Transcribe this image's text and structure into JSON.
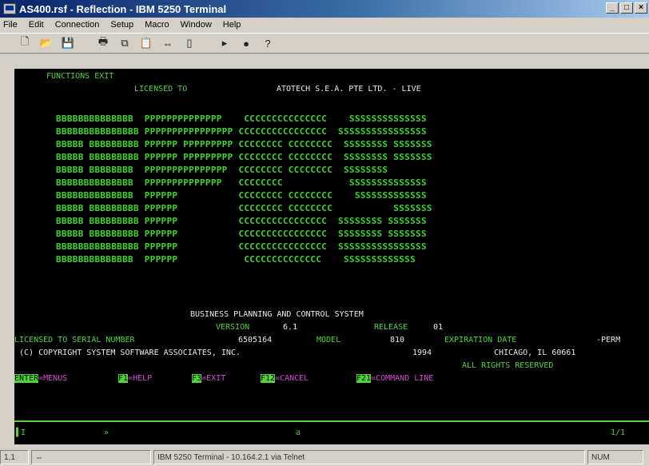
{
  "window": {
    "title": "AS400.rsf - Reflection - IBM 5250 Terminal",
    "buttons": [
      "_",
      "□",
      "×"
    ]
  },
  "menus": [
    "File",
    "Edit",
    "Connection",
    "Setup",
    "Macro",
    "Window",
    "Help"
  ],
  "toolbar_icons": [
    "new-icon",
    "open-icon",
    "save-icon",
    "print-icon",
    "copy-icon",
    "paste-icon",
    "connect-icon",
    "disconnect-icon",
    "record-icon",
    "stop-icon",
    "help-icon"
  ],
  "terminal": {
    "header_left": "FUNCTIONS EXIT",
    "licensed_label": "LICENSED TO",
    "licensee": "ATOTECH S.E.A. PTE LTD. - LIVE",
    "logo": [
      "BBBBBBBBBBBBBB  PPPPPPPPPPPPPP    CCCCCCCCCCCCCCC    SSSSSSSSSSSSSS",
      "BBBBBBBBBBBBBBB PPPPPPPPPPPPPPPP CCCCCCCCCCCCCCCC  SSSSSSSSSSSSSSSS",
      "BBBBB BBBBBBBBB PPPPPP PPPPPPPPP CCCCCCCC CCCCCCCC  SSSSSSSS SSSSSSS",
      "BBBBB BBBBBBBBB PPPPPP PPPPPPPPP CCCCCCCC CCCCCCCC  SSSSSSSS SSSSSSS",
      "BBBBB BBBBBBBB  PPPPPPPPPPPPPPP  CCCCCCCC CCCCCCCC  SSSSSSSS",
      "BBBBBBBBBBBBBB  PPPPPPPPPPPPPP   CCCCCCCC            SSSSSSSSSSSSSS",
      "BBBBBBBBBBBBBB  PPPPPP           CCCCCCCC CCCCCCCC    SSSSSSSSSSSSS",
      "BBBBB BBBBBBBBB PPPPPP           CCCCCCCC CCCCCCCC           SSSSSSS",
      "BBBBB BBBBBBBBB PPPPPP           CCCCCCCCCCCCCCCC  SSSSSSSS SSSSSSS",
      "BBBBB BBBBBBBBB PPPPPP           CCCCCCCCCCCCCCCC  SSSSSSSS SSSSSSS",
      "BBBBBBBBBBBBBBB PPPPPP           CCCCCCCCCCCCCCCC  SSSSSSSSSSSSSSSS",
      "BBBBBBBBBBBBBB  PPPPPP            CCCCCCCCCCCCCC    SSSSSSSSSSSSS"
    ],
    "system_name": "BUSINESS PLANNING AND CONTROL SYSTEM",
    "version_label": "VERSION",
    "version": "6.1",
    "release_label": "RELEASE",
    "release": "01",
    "serial_label": "LICENSED TO SERIAL NUMBER",
    "serial": "6505164",
    "model_label": "MODEL",
    "model": "810",
    "expiration_label": "EXPIRATION DATE",
    "expiration": "-PERM",
    "copyright_owner": "(C) COPYRIGHT SYSTEM SOFTWARE ASSOCIATES, INC.",
    "copyright_year": "1994",
    "location": "CHICAGO, IL 60661",
    "rights": "ALL RIGHTS RESERVED",
    "fkeys": [
      {
        "key": "ENTER",
        "label": "=MENUS"
      },
      {
        "key": "F1",
        "label": "=HELP"
      },
      {
        "key": "F3",
        "label": "=EXIT"
      },
      {
        "key": "F12",
        "label": "=CANCEL"
      },
      {
        "key": "F21",
        "label": "=COMMAND LINE"
      }
    ],
    "oia_left": "▌I",
    "oia_mid1": "»",
    "oia_mid2": "a",
    "oia_right": "1/1"
  },
  "status": {
    "cursor": "1,1",
    "connection": "IBM 5250 Terminal - 10.164.2.1 via Telnet",
    "num": "NUM"
  },
  "colors": {
    "green": "#4fd43a",
    "magenta": "#d24bd2",
    "white": "#e8e8e8"
  }
}
